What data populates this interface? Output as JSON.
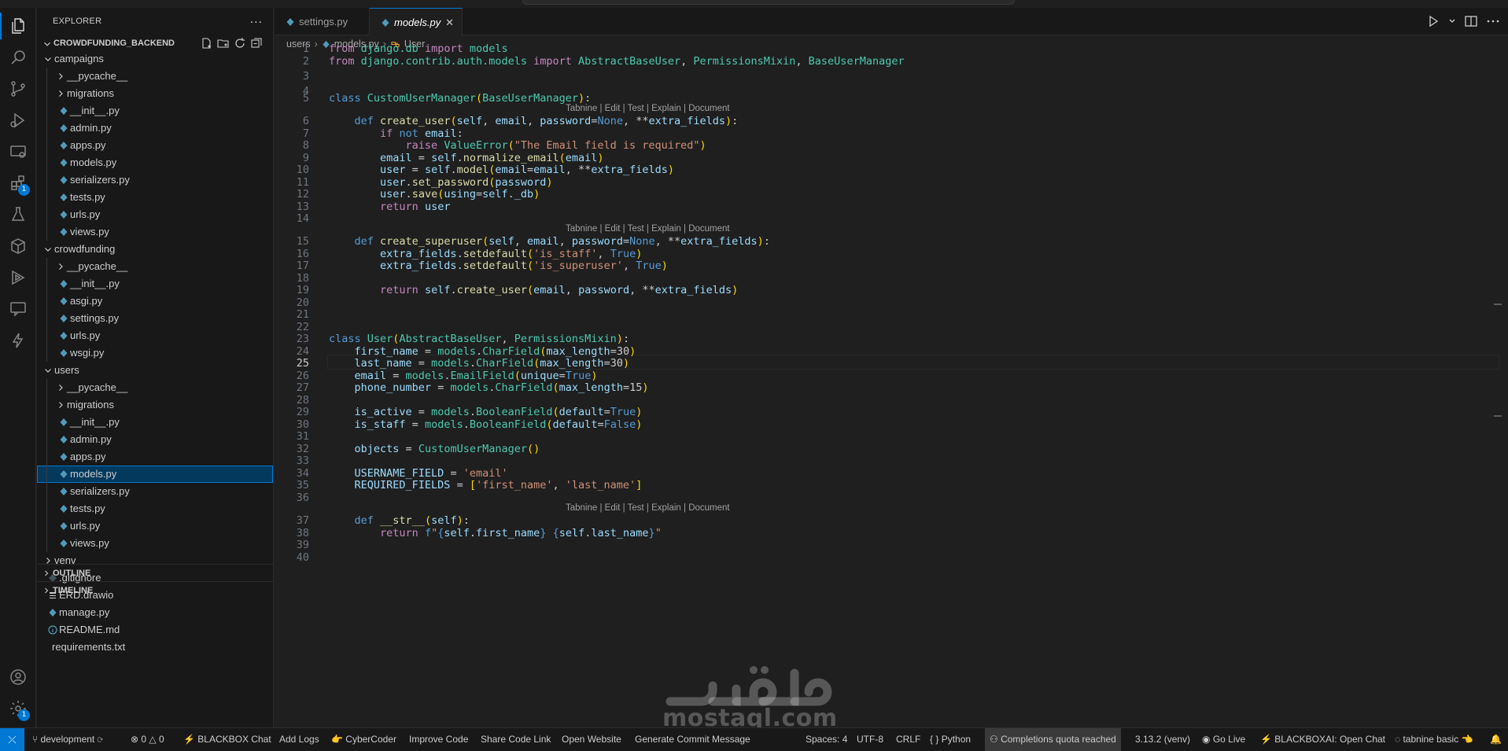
{
  "sidebar": {
    "title": "EXPLORER",
    "more": "...",
    "project": "CROWDFUNDING_BACKEND",
    "tree": [
      {
        "label": "campaigns",
        "type": "folder-open",
        "depth": 1
      },
      {
        "label": "__pycache__",
        "type": "folder",
        "depth": 2
      },
      {
        "label": "migrations",
        "type": "folder",
        "depth": 2
      },
      {
        "label": "__init__.py",
        "type": "py",
        "depth": 2
      },
      {
        "label": "admin.py",
        "type": "py",
        "depth": 2
      },
      {
        "label": "apps.py",
        "type": "py",
        "depth": 2
      },
      {
        "label": "models.py",
        "type": "py",
        "depth": 2
      },
      {
        "label": "serializers.py",
        "type": "py",
        "depth": 2
      },
      {
        "label": "tests.py",
        "type": "py",
        "depth": 2
      },
      {
        "label": "urls.py",
        "type": "py",
        "depth": 2
      },
      {
        "label": "views.py",
        "type": "py",
        "depth": 2
      },
      {
        "label": "crowdfunding",
        "type": "folder-open",
        "depth": 1
      },
      {
        "label": "__pycache__",
        "type": "folder",
        "depth": 2
      },
      {
        "label": "__init__.py",
        "type": "py",
        "depth": 2
      },
      {
        "label": "asgi.py",
        "type": "py",
        "depth": 2
      },
      {
        "label": "settings.py",
        "type": "py",
        "depth": 2
      },
      {
        "label": "urls.py",
        "type": "py",
        "depth": 2
      },
      {
        "label": "wsgi.py",
        "type": "py",
        "depth": 2
      },
      {
        "label": "users",
        "type": "folder-open",
        "depth": 1
      },
      {
        "label": "__pycache__",
        "type": "folder",
        "depth": 2
      },
      {
        "label": "migrations",
        "type": "folder",
        "depth": 2
      },
      {
        "label": "__init__.py",
        "type": "py",
        "depth": 2
      },
      {
        "label": "admin.py",
        "type": "py",
        "depth": 2
      },
      {
        "label": "apps.py",
        "type": "py",
        "depth": 2
      },
      {
        "label": "models.py",
        "type": "py",
        "depth": 2,
        "selected": true
      },
      {
        "label": "serializers.py",
        "type": "py",
        "depth": 2
      },
      {
        "label": "tests.py",
        "type": "py",
        "depth": 2
      },
      {
        "label": "urls.py",
        "type": "py",
        "depth": 2
      },
      {
        "label": "views.py",
        "type": "py",
        "depth": 2
      },
      {
        "label": "venv",
        "type": "folder",
        "depth": 1
      },
      {
        "label": ".gitignore",
        "type": "git",
        "depth": 1
      },
      {
        "label": "ERD.drawio",
        "type": "drawio",
        "depth": 1
      },
      {
        "label": "manage.py",
        "type": "py",
        "depth": 1
      },
      {
        "label": "README.md",
        "type": "info",
        "depth": 1
      },
      {
        "label": "requirements.txt",
        "type": "txt",
        "depth": 1
      }
    ],
    "outline": "OUTLINE",
    "timeline": "TIMELINE"
  },
  "activity": {
    "icons": [
      "files-icon",
      "search-icon",
      "source-control-icon",
      "run-debug-icon",
      "remote-explorer-icon",
      "extensions-icon",
      "testing-icon",
      "docker-icon",
      "tabnine-icon",
      "chat-icon",
      "lightning-icon"
    ],
    "extensions_badge": "1",
    "settings_badge": "1"
  },
  "tabs": [
    {
      "label": "settings.py",
      "active": false
    },
    {
      "label": "models.py",
      "active": true,
      "close": "✕"
    }
  ],
  "breadcrumb": {
    "folder": "users",
    "file": "models.py",
    "symbol": "User"
  },
  "codelens": "Tabnine | Edit | Test | Explain | Document",
  "code": {
    "current_line": 25
  },
  "statusbar": {
    "branch": "development",
    "problems_errors": "0",
    "problems_warnings": "0",
    "items_left": [
      "⚡ BLACKBOX Chat",
      "Add Logs",
      "👉 CyberCoder",
      "Improve Code",
      "Share Code Link",
      "Open Website",
      "Generate Commit Message"
    ],
    "spaces": "Spaces: 4",
    "encoding": "UTF-8",
    "eol": "CRLF",
    "language": "Python",
    "completions": "Completions quota reached",
    "interpreter": "3.13.2 (venv)",
    "golive": "Go Live",
    "blackboxai": "⚡ BLACKBOXAI: Open Chat",
    "tabnine": "tabnine basic 👈"
  },
  "watermark": {
    "text": "mostaql.com"
  }
}
